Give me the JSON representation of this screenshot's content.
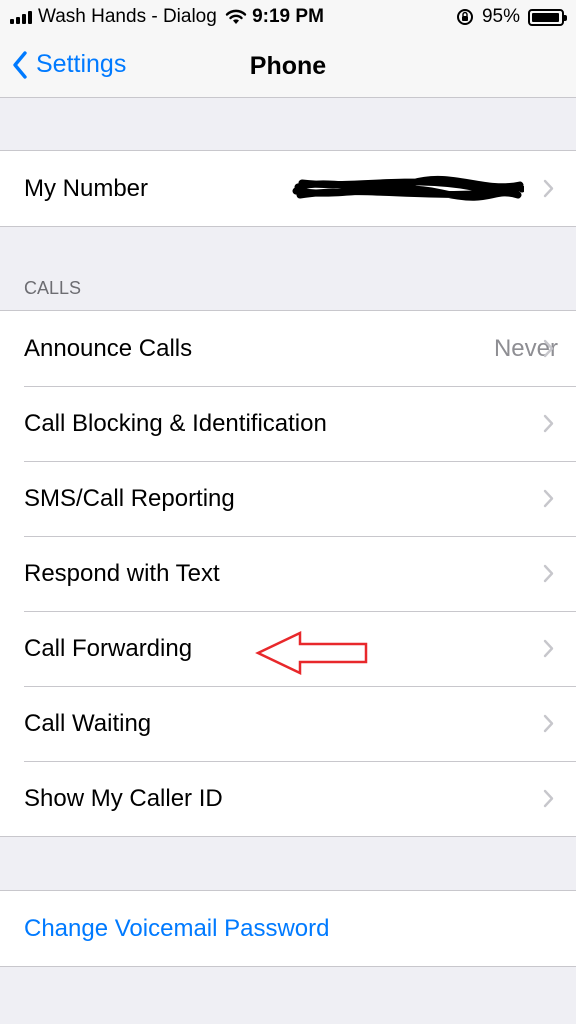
{
  "status_bar": {
    "carrier": "Wash Hands - Dialog",
    "time": "9:19 PM",
    "battery": "95%",
    "battery_level": 0.95,
    "icons": [
      "signal-icon",
      "wifi-icon",
      "rotation-lock-icon",
      "battery-icon"
    ]
  },
  "nav": {
    "back_label": "Settings",
    "title": "Phone"
  },
  "my_number": {
    "label": "My Number",
    "value_redacted": true
  },
  "calls": {
    "header": "CALLS",
    "items": [
      {
        "label": "Announce Calls",
        "value": "Never"
      },
      {
        "label": "Call Blocking & Identification",
        "value": ""
      },
      {
        "label": "SMS/Call Reporting",
        "value": ""
      },
      {
        "label": "Respond with Text",
        "value": ""
      },
      {
        "label": "Call Forwarding",
        "value": ""
      },
      {
        "label": "Call Waiting",
        "value": ""
      },
      {
        "label": "Show My Caller ID",
        "value": ""
      }
    ]
  },
  "voicemail": {
    "change_password_label": "Change Voicemail Password"
  },
  "colors": {
    "accent": "#007aff",
    "background": "#efeff4",
    "annotation_arrow": "#e8282b"
  }
}
